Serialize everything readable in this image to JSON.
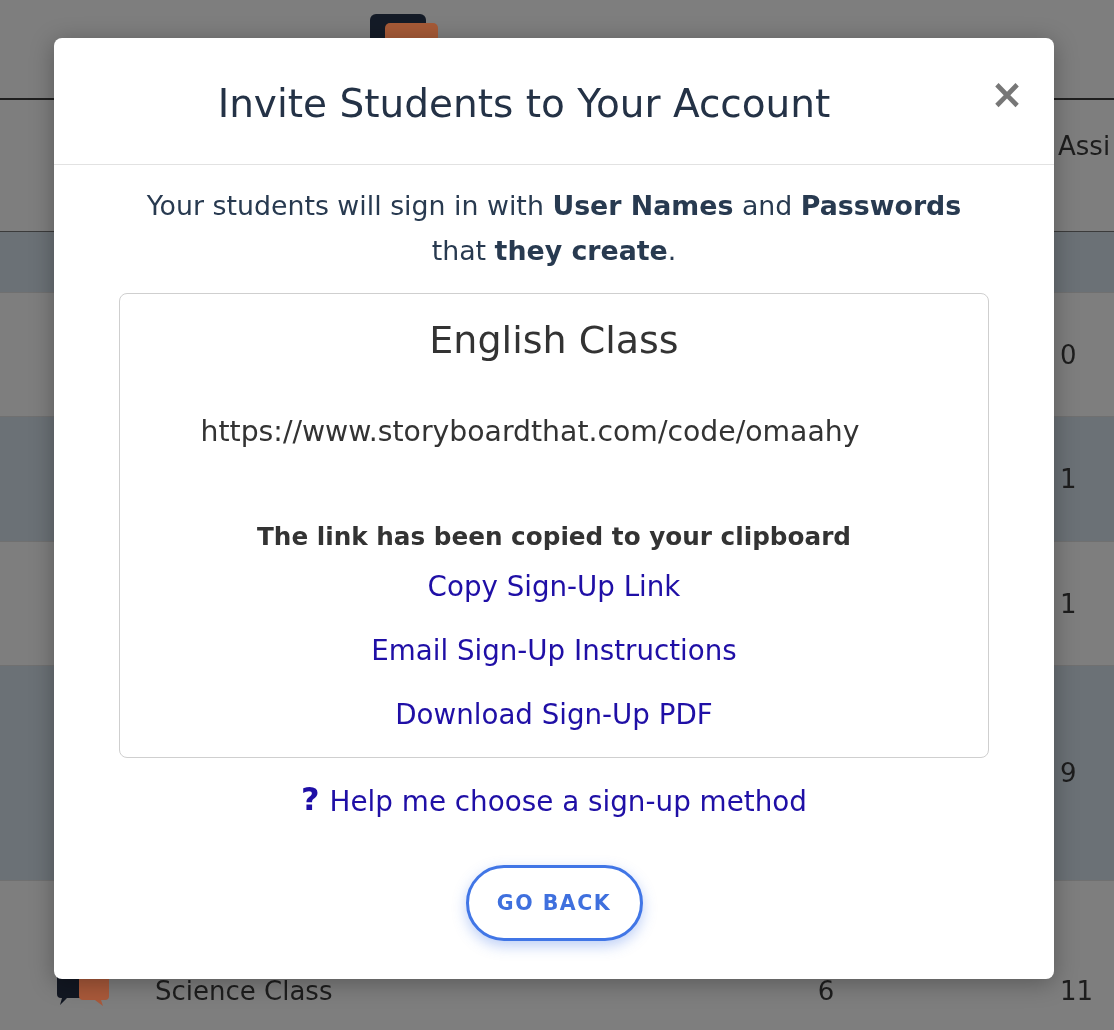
{
  "background_table": {
    "column_3_header": "Assi",
    "rows": [
      {
        "column_3": "0"
      },
      {
        "column_3": "1"
      },
      {
        "column_3": "1"
      },
      {
        "column_3": "9"
      },
      {
        "column_1": "Science Class",
        "column_2": "6",
        "column_3": "11"
      }
    ]
  },
  "dialog": {
    "title": "Invite Students to Your Account",
    "close_glyph": "×",
    "intro": "Your students will sign in with **User Names** and **Passwords** that **they create**.",
    "class_card": {
      "class_name": "English Class",
      "signup_url": "https://www.storyboardthat.com/code/omaahy",
      "status_message": "The link has been copied to your clipboard",
      "links": [
        "Copy Sign-Up Link",
        "Email Sign-Up Instructions",
        "Download Sign-Up PDF"
      ]
    },
    "help_link": {
      "icon_glyph": "?",
      "label": "Help me choose a sign-up method"
    },
    "buttons": [
      "GO BACK"
    ]
  }
}
